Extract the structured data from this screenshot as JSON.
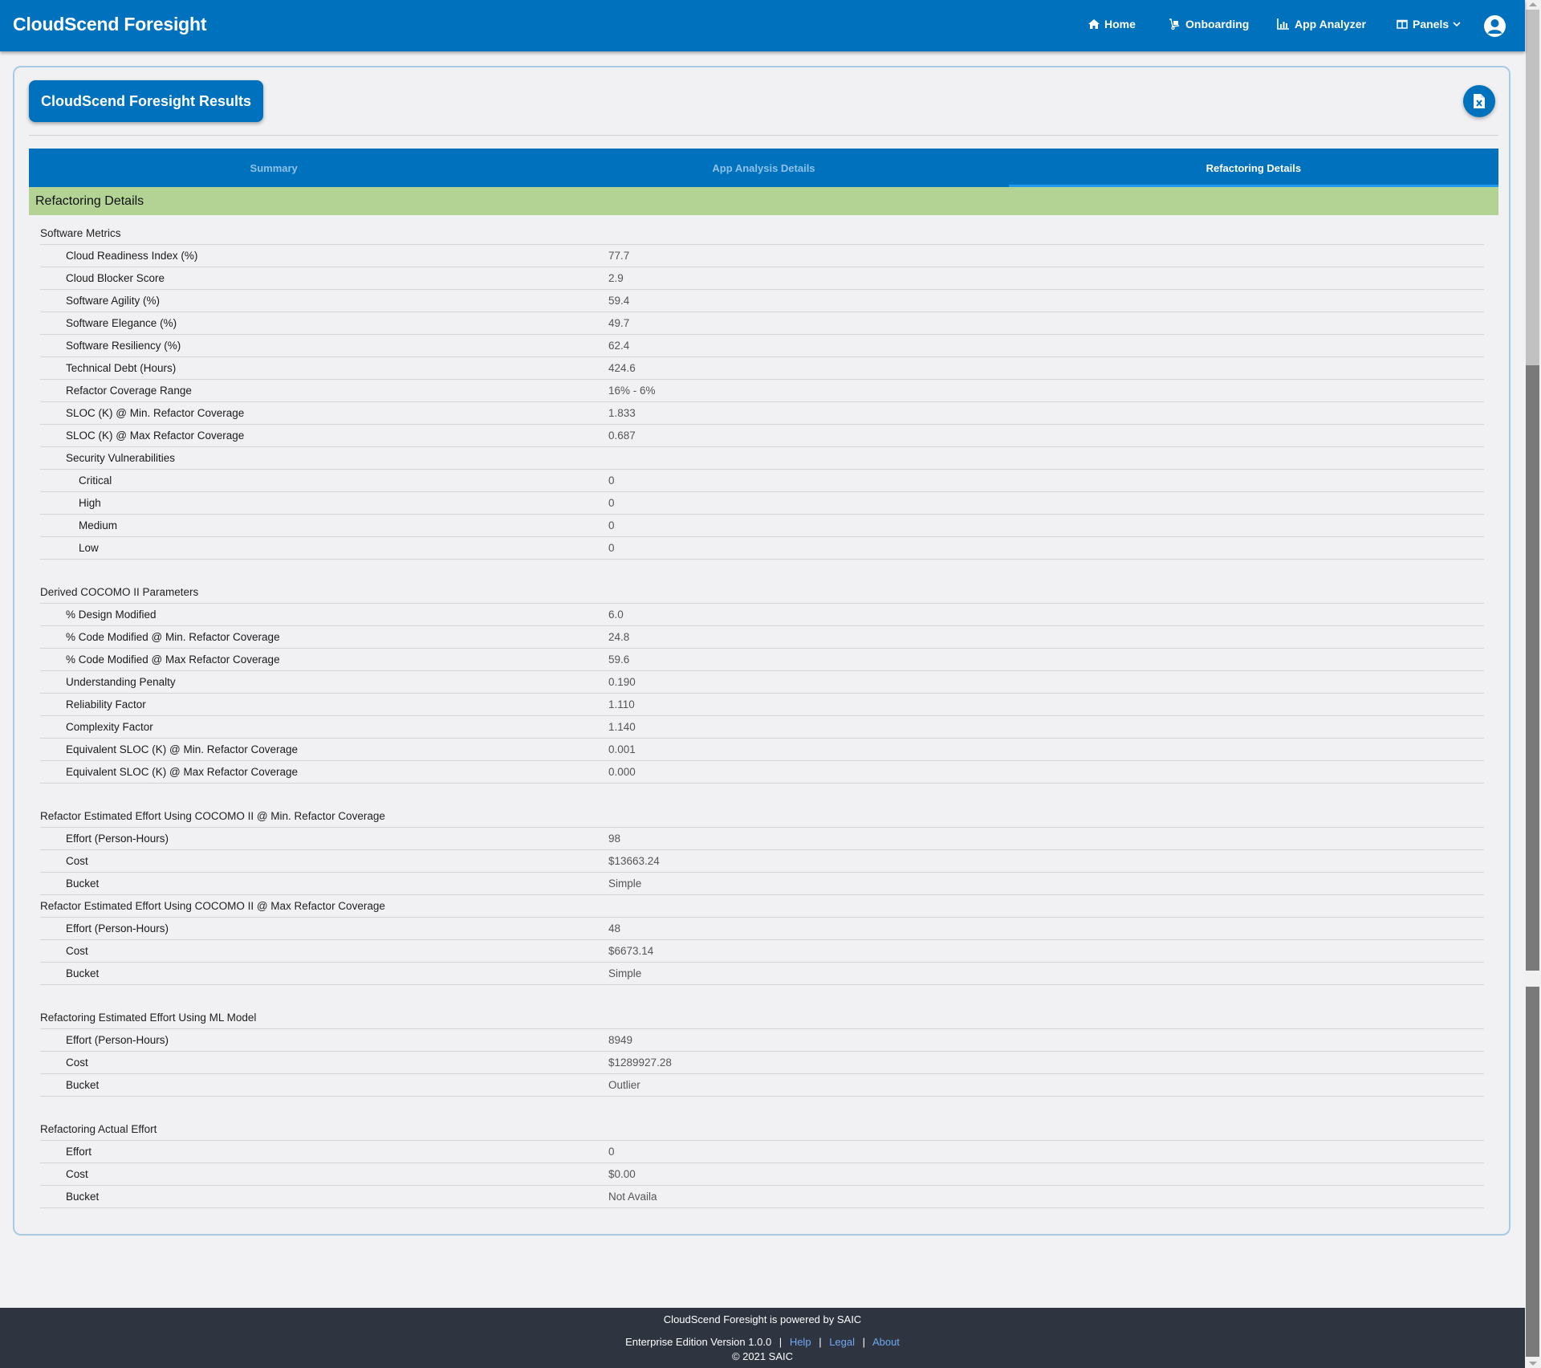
{
  "header": {
    "brand": "CloudScend Foresight",
    "nav": [
      {
        "label": "Home",
        "icon": "home-icon"
      },
      {
        "label": "Onboarding",
        "icon": "hand-truck-icon"
      },
      {
        "label": "App Analyzer",
        "icon": "bar-chart-icon"
      },
      {
        "label": "Panels",
        "icon": "columns-icon"
      }
    ],
    "accent": "#0071bc"
  },
  "page": {
    "title": "CloudScend Foresight Results",
    "export_icon": "excel-file-icon",
    "tabs": [
      {
        "label": "Summary",
        "active": false
      },
      {
        "label": "App Analysis Details",
        "active": false
      },
      {
        "label": "Refactoring Details",
        "active": true
      }
    ],
    "section_title": "Refactoring Details",
    "section_color": "#b2d394"
  },
  "groups": [
    {
      "title": "Software Metrics",
      "rows": [
        {
          "label": "Cloud Readiness Index (%)",
          "value": "77.7"
        },
        {
          "label": "Cloud Blocker Score",
          "value": "2.9"
        },
        {
          "label": "Software Agility (%)",
          "value": "59.4"
        },
        {
          "label": "Software Elegance (%)",
          "value": "49.7"
        },
        {
          "label": "Software Resiliency (%)",
          "value": "62.4"
        },
        {
          "label": "Technical Debt (Hours)",
          "value": "424.6"
        },
        {
          "label": "Refactor Coverage Range",
          "value": "16% - 6%"
        },
        {
          "label": "SLOC (K) @ Min. Refactor Coverage",
          "value": "1.833"
        },
        {
          "label": "SLOC (K) @ Max Refactor Coverage",
          "value": "0.687"
        },
        {
          "label": "Security Vulnerabilities",
          "value": ""
        },
        {
          "label": "Critical",
          "value": "0",
          "sub": true
        },
        {
          "label": "High",
          "value": "0",
          "sub": true
        },
        {
          "label": "Medium",
          "value": "0",
          "sub": true
        },
        {
          "label": "Low",
          "value": "0",
          "sub": true
        }
      ]
    },
    {
      "title": "Derived COCOMO II Parameters",
      "rows": [
        {
          "label": "% Design Modified",
          "value": "6.0"
        },
        {
          "label": "% Code Modified @ Min. Refactor Coverage",
          "value": "24.8"
        },
        {
          "label": "% Code Modified @ Max Refactor Coverage",
          "value": "59.6"
        },
        {
          "label": "Understanding Penalty",
          "value": "0.190"
        },
        {
          "label": "Reliability Factor",
          "value": "1.110"
        },
        {
          "label": "Complexity Factor",
          "value": "1.140"
        },
        {
          "label": "Equivalent SLOC (K) @ Min. Refactor Coverage",
          "value": "0.001"
        },
        {
          "label": "Equivalent SLOC (K) @ Max Refactor Coverage",
          "value": "0.000"
        }
      ]
    },
    {
      "title": "Refactor Estimated Effort Using COCOMO II @ Min. Refactor Coverage",
      "rows": [
        {
          "label": "Effort (Person-Hours)",
          "value": "98"
        },
        {
          "label": "Cost",
          "value": "$13663.24"
        },
        {
          "label": "Bucket",
          "value": "Simple"
        }
      ]
    },
    {
      "title": "Refactor Estimated Effort Using COCOMO II @ Max Refactor Coverage",
      "rows": [
        {
          "label": "Effort (Person-Hours)",
          "value": "48"
        },
        {
          "label": "Cost",
          "value": "$6673.14"
        },
        {
          "label": "Bucket",
          "value": "Simple"
        }
      ]
    },
    {
      "title": "Refactoring Estimated Effort Using ML Model",
      "rows": [
        {
          "label": "Effort (Person-Hours)",
          "value": "8949"
        },
        {
          "label": "Cost",
          "value": "$1289927.28"
        },
        {
          "label": "Bucket",
          "value": "Outlier"
        }
      ]
    },
    {
      "title": "Refactoring Actual Effort",
      "rows": [
        {
          "label": "Effort",
          "value": "0"
        },
        {
          "label": "Cost",
          "value": "$0.00"
        },
        {
          "label": "Bucket",
          "value": "Not Availa"
        }
      ]
    }
  ],
  "footer": {
    "powered": "CloudScend Foresight is powered by SAIC",
    "edition": "Enterprise Edition Version 1.0.0",
    "links": [
      "Help",
      "Legal",
      "About"
    ],
    "separator": "|",
    "copyright": "© 2021 SAIC"
  }
}
